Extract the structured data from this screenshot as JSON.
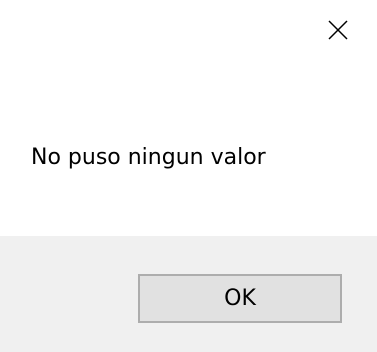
{
  "dialog": {
    "message": "No puso ningun valor",
    "ok_label": "OK",
    "close_icon": "close-icon"
  }
}
